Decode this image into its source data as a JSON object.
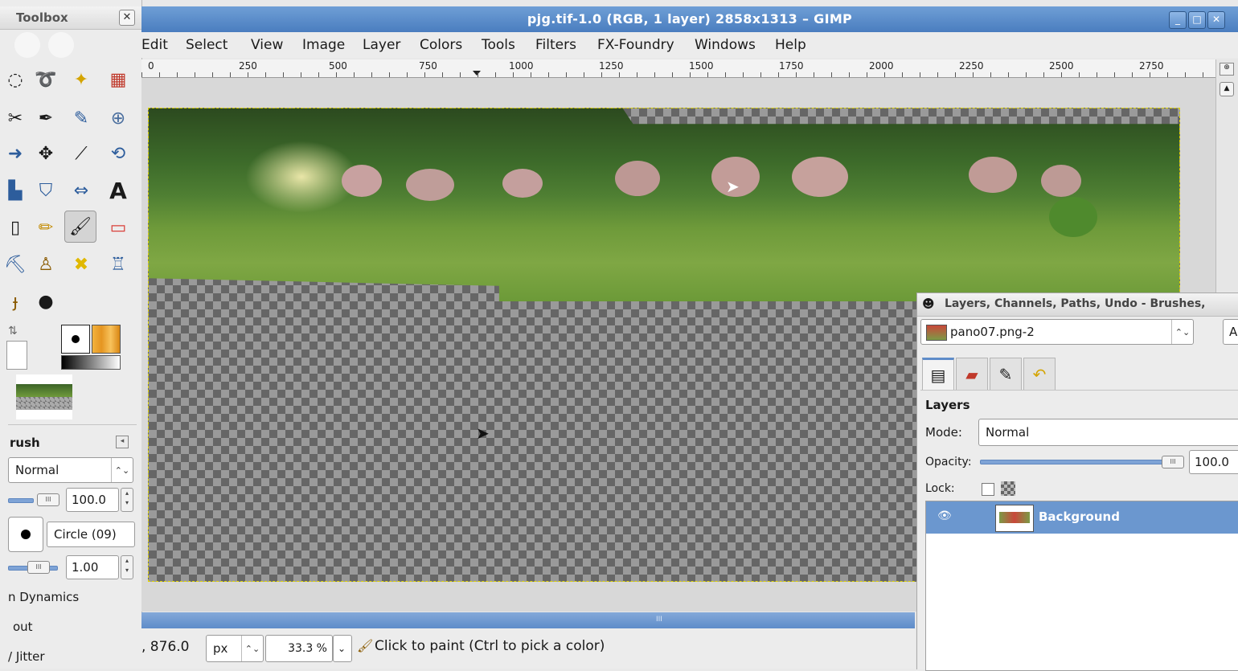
{
  "toolbox": {
    "title": "Toolbox",
    "close_glyph": "✕",
    "tool_options": {
      "header": "rush",
      "mode": "Normal",
      "opacity": "100.0",
      "brush": "Circle (09)",
      "size": "1.00",
      "dynamics": "n Dynamics",
      "fade": "out",
      "jitter": "/ Jitter"
    }
  },
  "window": {
    "title": "pjg.tif-1.0 (RGB, 1 layer) 2858x1313 – GIMP",
    "menus": [
      "Edit",
      "Select",
      "View",
      "Image",
      "Layer",
      "Colors",
      "Tools",
      "Filters",
      "FX-Foundry",
      "Windows",
      "Help"
    ],
    "ruler_labels": [
      "0",
      "250",
      "500",
      "750",
      "1000",
      "1250",
      "1500",
      "1750",
      "2000",
      "2250",
      "2500",
      "2750"
    ],
    "status": {
      "coords": ", 876.0",
      "unit": "px",
      "zoom": "33.3 %",
      "message": "Click to paint (Ctrl to pick a color)"
    }
  },
  "dock": {
    "title": "Layers, Channels, Paths, Undo - Brushes,",
    "image_select": "pano07.png-2",
    "auto_label": "A",
    "section": "Layers",
    "mode_label": "Mode:",
    "mode_value": "Normal",
    "opacity_label": "Opacity:",
    "opacity_value": "100.0",
    "lock_label": "Lock:",
    "layers": [
      {
        "name": "Background",
        "visible": true
      }
    ]
  },
  "colors": {
    "title_bar": "#5a8cc8",
    "selection": "#6b97cf",
    "fg": "#000000",
    "bg": "#f2a531"
  }
}
